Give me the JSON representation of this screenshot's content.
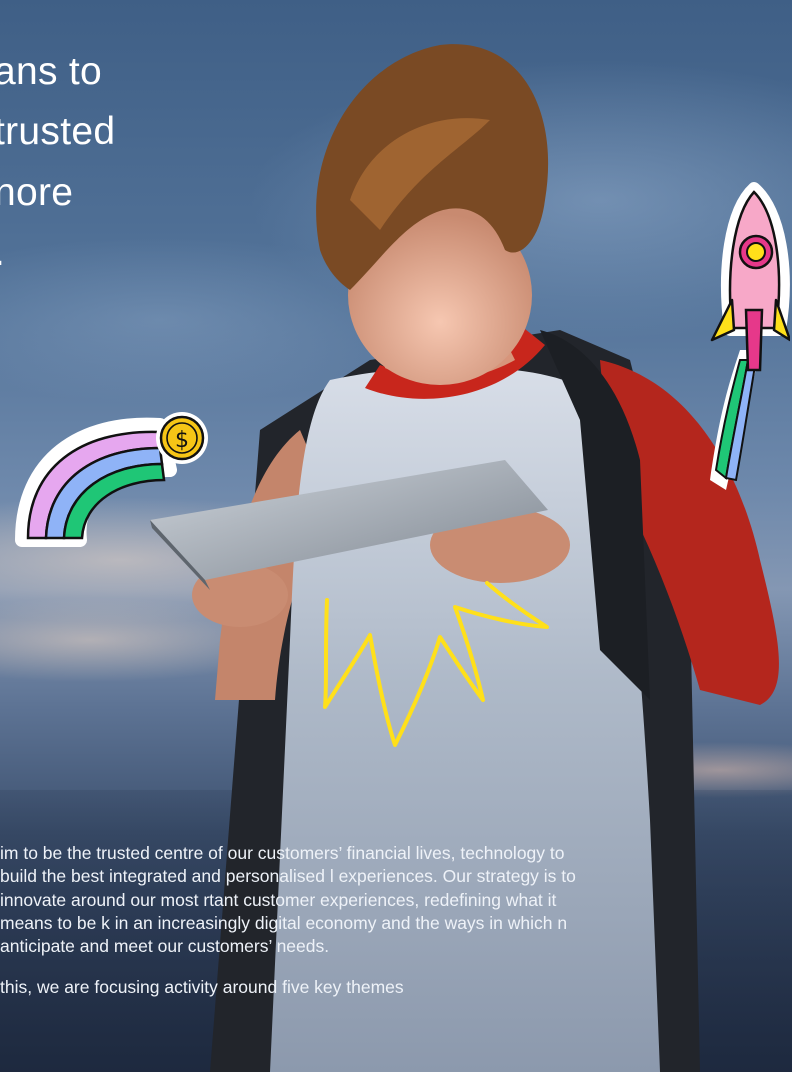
{
  "headline": {
    "line1": "ans to",
    "line2": "trusted",
    "line3": "nore",
    "line4": "."
  },
  "body": {
    "paragraph1": "im to be the trusted centre of our customers’ financial lives, technology to build the best integrated and personalised l experiences. Our strategy is to innovate around our most rtant customer experiences, redefining what it means to be k in an increasingly digital economy and the ways in which n anticipate and meet our customers’ needs.",
    "paragraph2": " this, we are focusing activity around five key themes"
  },
  "stickers": {
    "rainbow_coin": "rainbow-coin-sticker",
    "rocket": "rocket-sticker",
    "spark": "spark-doodle"
  },
  "colors": {
    "doodle_yellow": "#ffe01a",
    "rocket_pink": "#f7a8c8",
    "coin_gold": "#f6c516"
  }
}
